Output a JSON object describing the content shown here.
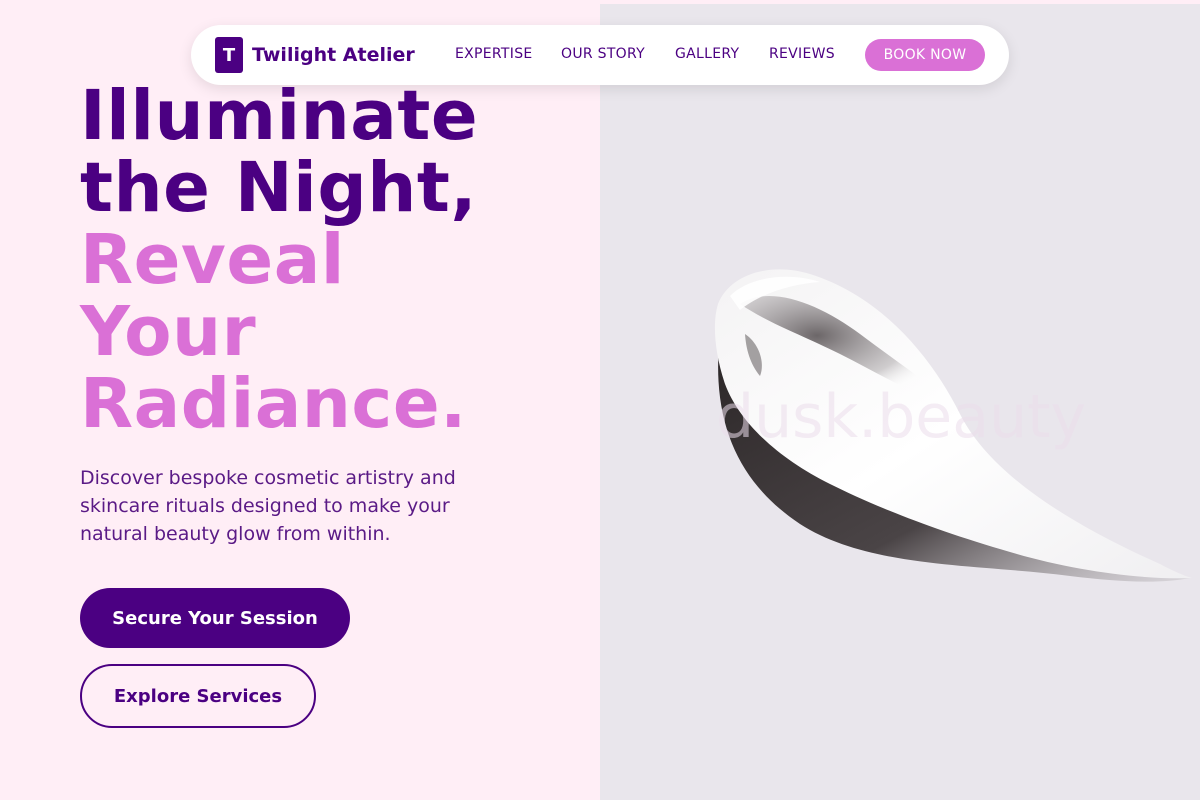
{
  "brand": {
    "mark": "T",
    "name": "Twilight Atelier"
  },
  "nav": {
    "links": [
      "EXPERTISE",
      "OUR STORY",
      "GALLERY",
      "REVIEWS"
    ],
    "cta": "BOOK NOW"
  },
  "hero": {
    "headline_dark": [
      "Illuminate",
      "the Night,"
    ],
    "headline_accent": [
      "Reveal",
      "Your",
      "Radiance."
    ],
    "description": "Discover bespoke cosmetic artistry and skincare rituals designed to make your natural beauty glow from within.",
    "primary_button": "Secure Your Session",
    "secondary_button": "Explore Services"
  },
  "image": {
    "watermark": "dusk.beauty",
    "subject": "cream-swatch"
  },
  "colors": {
    "primary": "#4b0082",
    "accent": "#da70d6",
    "background": "#ffeef6",
    "image_background": "#e9e6ec"
  }
}
